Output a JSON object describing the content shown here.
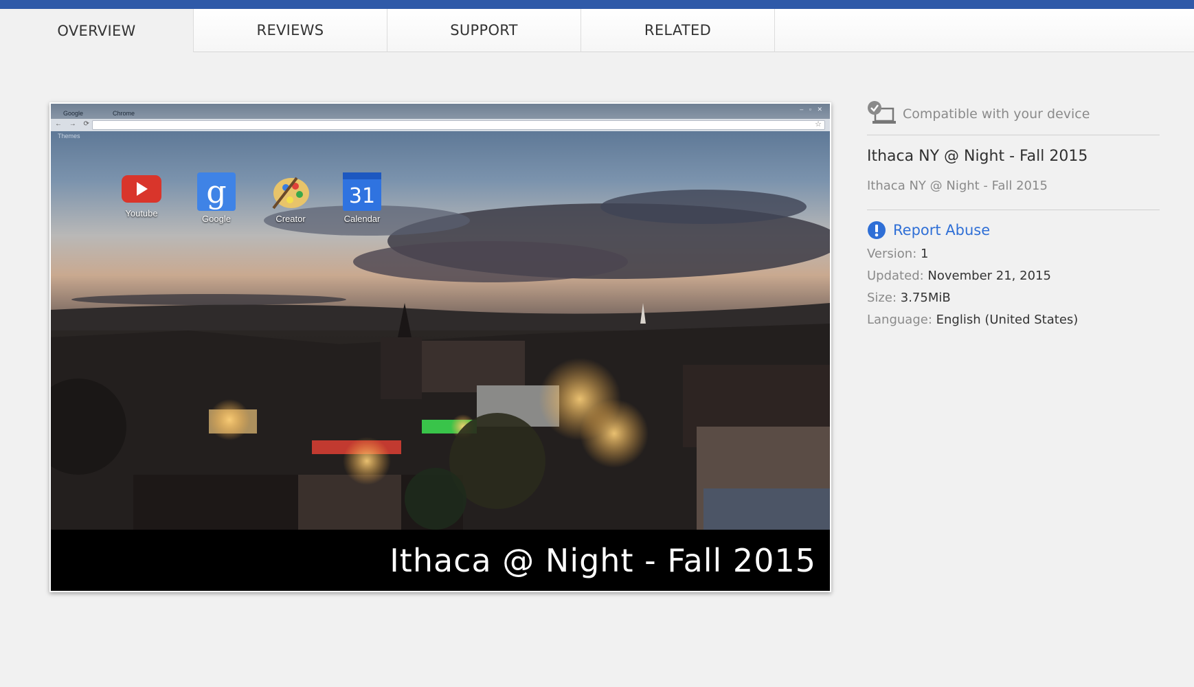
{
  "colors": {
    "top_bar": "#2f5aa8",
    "link": "#2f6fd6",
    "report_icon": "#2f6fd6"
  },
  "tabs": [
    {
      "label": "OVERVIEW",
      "active": true
    },
    {
      "label": "REVIEWS",
      "active": false
    },
    {
      "label": "SUPPORT",
      "active": false
    },
    {
      "label": "RELATED",
      "active": false
    }
  ],
  "screenshot": {
    "caption": "Ithaca @ Night - Fall 2015",
    "browser_tabs": [
      "Google",
      "Chrome"
    ],
    "bookmarks_label": "Themes",
    "apps": [
      {
        "label": "Youtube",
        "icon": "youtube-icon"
      },
      {
        "label": "Google",
        "icon": "google-icon"
      },
      {
        "label": "Creator",
        "icon": "creator-palette-icon"
      },
      {
        "label": "Calendar",
        "icon": "calendar-icon",
        "day": "31"
      }
    ]
  },
  "sidebar": {
    "compatibility": {
      "text": "Compatible with your device",
      "icon": "device-check-icon"
    },
    "title": "Ithaca NY @ Night - Fall 2015",
    "subtitle": "Ithaca NY @ Night - Fall 2015",
    "report": {
      "label": "Report Abuse",
      "icon": "exclamation-icon"
    },
    "details": [
      {
        "key": "Version:",
        "value": "1"
      },
      {
        "key": "Updated:",
        "value": "November 21, 2015"
      },
      {
        "key": "Size:",
        "value": "3.75MiB"
      },
      {
        "key": "Language:",
        "value": "English (United States)"
      }
    ]
  }
}
